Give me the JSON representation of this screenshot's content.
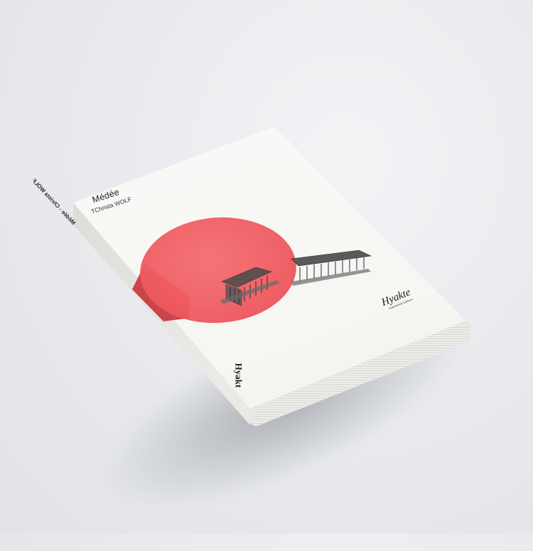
{
  "book": {
    "title": "Médée",
    "author": "TChrista WOLF",
    "spine_text": "Médée - Christa WOLF",
    "spine_logo": "Hyakt",
    "publisher_logo": "Hyakte",
    "publisher_subtitle": "Hyperborée Editions"
  },
  "colors": {
    "red_disk": "#ef5b60",
    "cover": "#f7f7f4",
    "background": "#e6e8eb"
  },
  "illustration": "greek-temple-engraving"
}
